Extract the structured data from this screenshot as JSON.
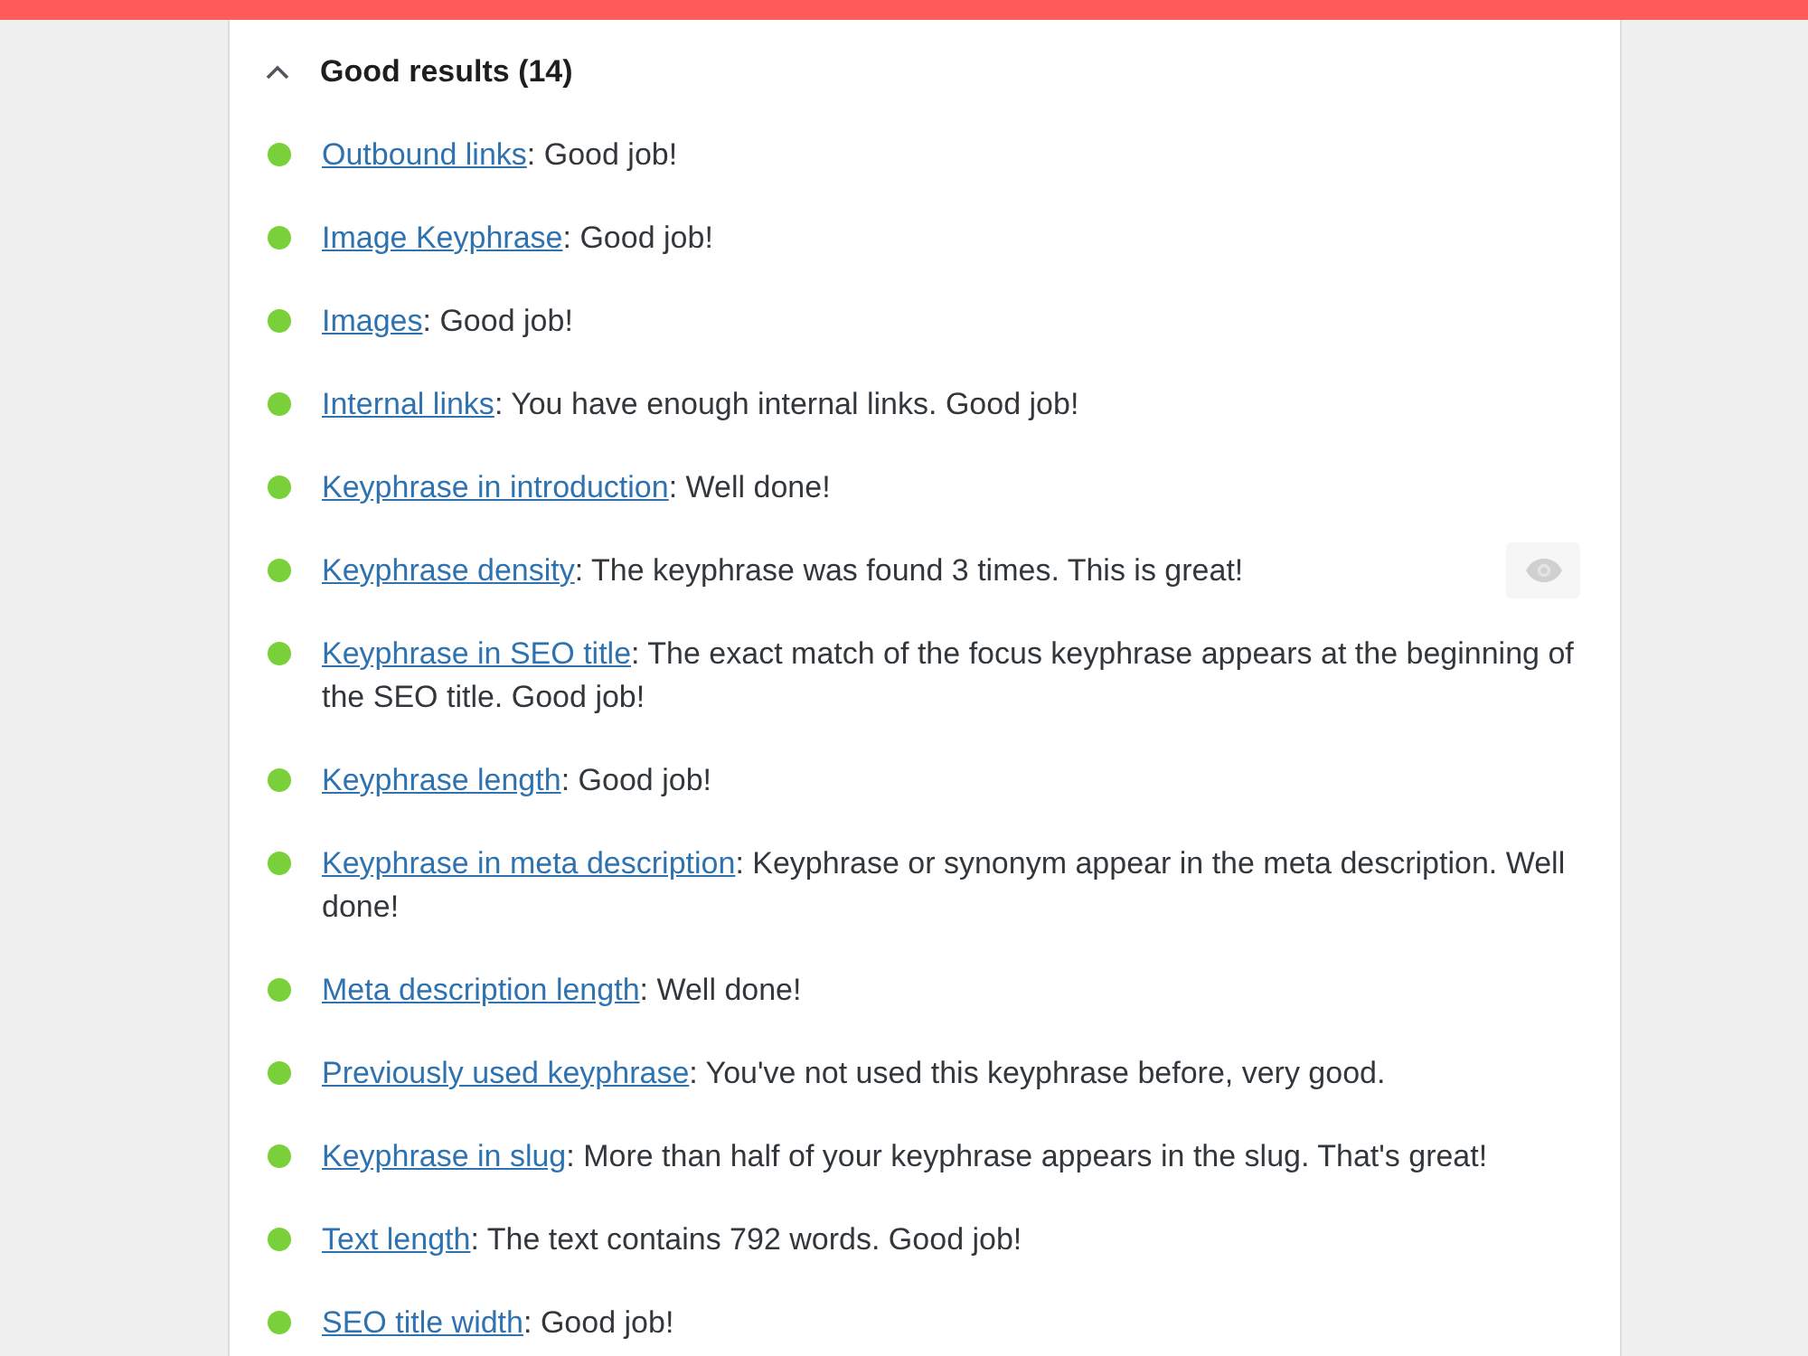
{
  "section": {
    "title": "Good results (14)",
    "expanded": true,
    "items": [
      {
        "link": "Outbound links",
        "message": ": Good job!",
        "color": "#7ad03a"
      },
      {
        "link": "Image Keyphrase",
        "message": ": Good job!",
        "color": "#7ad03a"
      },
      {
        "link": "Images",
        "message": ": Good job!",
        "color": "#7ad03a"
      },
      {
        "link": "Internal links",
        "message": ": You have enough internal links. Good job!",
        "color": "#7ad03a"
      },
      {
        "link": "Keyphrase in introduction",
        "message": ": Well done!",
        "color": "#7ad03a"
      },
      {
        "link": "Keyphrase density",
        "message": ": The keyphrase was found 3 times. This is great!",
        "color": "#7ad03a",
        "eye_button": {
          "disabled": true
        }
      },
      {
        "link": "Keyphrase in SEO title",
        "message": ": The exact match of the focus keyphrase appears at the beginning of the SEO title. Good job!",
        "color": "#7ad03a"
      },
      {
        "link": "Keyphrase length",
        "message": ": Good job!",
        "color": "#7ad03a"
      },
      {
        "link": "Keyphrase in meta description",
        "message": ": Keyphrase or synonym appear in the meta description. Well done!",
        "color": "#7ad03a"
      },
      {
        "link": "Meta description length",
        "message": ": Well done!",
        "color": "#7ad03a"
      },
      {
        "link": "Previously used keyphrase",
        "message": ": You've not used this keyphrase before, very good.",
        "color": "#7ad03a"
      },
      {
        "link": "Keyphrase in slug",
        "message": ": More than half of your keyphrase appears in the slug. That's great!",
        "color": "#7ad03a"
      },
      {
        "link": "Text length",
        "message": ": The text contains 792 words. Good job!",
        "color": "#7ad03a"
      },
      {
        "link": "SEO title width",
        "message": ": Good job!",
        "color": "#7ad03a"
      }
    ]
  }
}
